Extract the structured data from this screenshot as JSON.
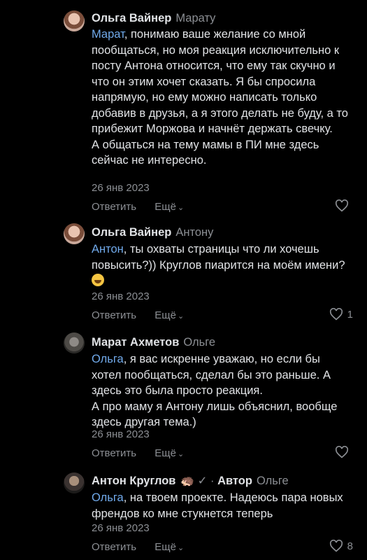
{
  "comments": [
    {
      "author": "Ольга Вайнер",
      "reply_to": "Марату",
      "mention": "Марат",
      "text": ", понимаю ваше желание со мной пообщаться, но моя реакция исключительно к посту Антона относится, что ему так скучно и что он этим хочет сказать. Я бы спросила напрямую, но ему можно написать только добавив в друзья, а я этого делать не буду, а то прибежит Моржова и начнёт держать свечку.\nА общаться на тему мамы в ПИ мне здесь сейчас не интересно.",
      "date": "26 янв 2023",
      "reply_label": "Ответить",
      "more_label": "Ещё",
      "likes": ""
    },
    {
      "author": "Ольга Вайнер",
      "reply_to": "Антону",
      "mention": "Антон",
      "text": ", ты охваты страницы что ли хочешь повысить?)) Круглов пиарится на моём имени?",
      "date": "26 янв 2023",
      "reply_label": "Ответить",
      "more_label": "Ещё",
      "likes": "1"
    },
    {
      "author": "Марат Ахметов",
      "reply_to": "Ольге",
      "mention": "Ольга",
      "text": ", я вас искренне уважаю, но если бы хотел пообщаться, сделал бы это раньше. А здесь это была просто реакция.\nА про маму я Антону лишь объяснил, вообще здесь другая тема.)",
      "date": "26 янв 2023",
      "reply_label": "Ответить",
      "more_label": "Ещё",
      "likes": ""
    },
    {
      "author": "Антон Круглов",
      "badge_icons": "🦔 ✓ ·",
      "author_tag": "Автор",
      "reply_to": "Ольге",
      "mention": "Ольга",
      "text": ", на твоем проекте. Надеюсь пара новых френдов ко мне стукнется теперь",
      "date": "26 янв 2023",
      "reply_label": "Ответить",
      "more_label": "Ещё",
      "likes": "8"
    }
  ],
  "colors": {
    "background": "#000000",
    "text": "#e1e3e6",
    "muted": "#8c8f94",
    "mention": "#71aaeb"
  }
}
